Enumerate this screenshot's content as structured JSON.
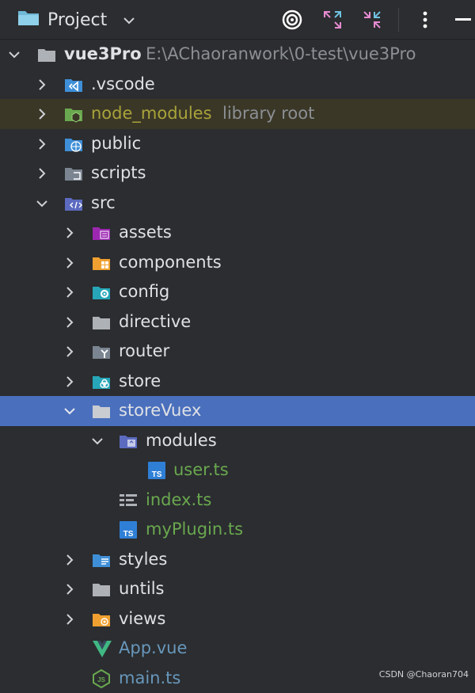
{
  "toolbar": {
    "title": "Project",
    "icons": [
      "project-folder-icon",
      "chevron-down-icon",
      "target-icon",
      "expand-icon",
      "collapse-icon",
      "kebab-menu-icon",
      "minimize-icon"
    ]
  },
  "tree": {
    "root": {
      "name": "vue3Pro",
      "path": "E:\\AChaoranwork\\0-test\\vue3Pro"
    },
    "items": [
      {
        "label": ".vscode"
      },
      {
        "label": "node_modules",
        "suffix": "library root"
      },
      {
        "label": "public"
      },
      {
        "label": "scripts"
      },
      {
        "label": "src"
      },
      {
        "label": "assets"
      },
      {
        "label": "components"
      },
      {
        "label": "config"
      },
      {
        "label": "directive"
      },
      {
        "label": "router"
      },
      {
        "label": "store"
      },
      {
        "label": "storeVuex"
      },
      {
        "label": "modules"
      },
      {
        "label": "user.ts",
        "badge": "TS"
      },
      {
        "label": "index.ts"
      },
      {
        "label": "myPlugin.ts",
        "badge": "TS"
      },
      {
        "label": "styles"
      },
      {
        "label": "untils"
      },
      {
        "label": "views"
      },
      {
        "label": "App.vue"
      },
      {
        "label": "main.ts"
      }
    ]
  },
  "colors": {
    "background": "#2b2d30",
    "selection": "#4a6fbd",
    "library_row": "#3a3727",
    "changed_file": "#6aa84f",
    "library_text": "#a9a33a"
  },
  "watermark": "CSDN @Chaoran704"
}
